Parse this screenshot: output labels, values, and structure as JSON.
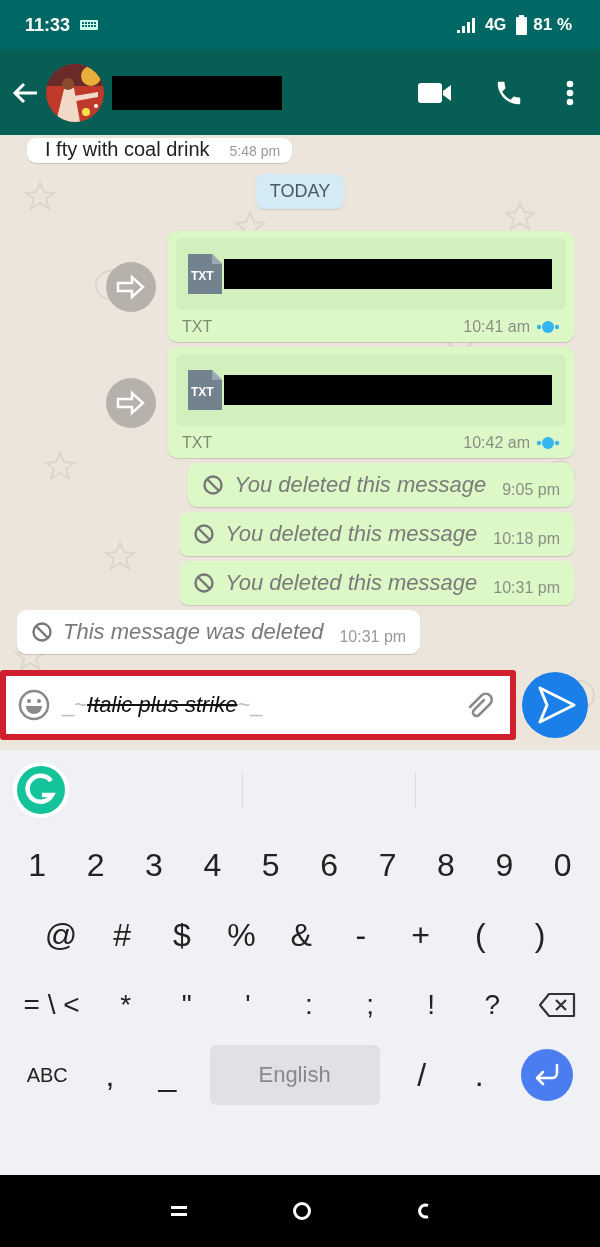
{
  "status_bar": {
    "time": "11:33",
    "network": "4G",
    "battery": "81 %"
  },
  "header": {
    "kind": "chat"
  },
  "messages": [
    {
      "kind": "text",
      "outgoing": false,
      "text": "I fty with coal drink",
      "time": "5:48 pm"
    },
    {
      "kind": "date",
      "text": "TODAY"
    },
    {
      "kind": "file",
      "outgoing": true,
      "file_type": "TXT",
      "label": "TXT",
      "time": "10:41 am",
      "read": true
    },
    {
      "kind": "file",
      "outgoing": true,
      "file_type": "TXT",
      "label": "TXT",
      "time": "10:42 am",
      "read": true
    },
    {
      "kind": "deleted",
      "outgoing": true,
      "text": "You deleted this message",
      "time": "9:05 pm"
    },
    {
      "kind": "deleted",
      "outgoing": true,
      "text": "You deleted this message",
      "time": "10:18 pm"
    },
    {
      "kind": "deleted",
      "outgoing": true,
      "text": "You deleted this message",
      "time": "10:31 pm"
    },
    {
      "kind": "deleted",
      "outgoing": false,
      "text": "This message was deleted",
      "time": "10:31 pm"
    }
  ],
  "composer": {
    "prefix": "_~",
    "value": "Italic plus strike",
    "suffix": "~_",
    "highlighted": true
  },
  "keyboard": {
    "number_keys": {
      "keys": [
        "1",
        "2",
        "3",
        "4",
        "5",
        "6",
        "7",
        "8",
        "9",
        "0"
      ]
    },
    "symbol_keys": {
      "keys": [
        "@",
        "#",
        "$",
        "%",
        "&",
        "-",
        "+",
        "(",
        ")"
      ]
    },
    "punctuation_keys": {
      "keys": [
        "= \\ <",
        "*",
        "\"",
        "'",
        ":",
        ";",
        "!",
        "?"
      ]
    },
    "bottom": {
      "left": "ABC",
      "keys": [
        ",",
        "_"
      ],
      "space": "English",
      "keys_right": [
        "/",
        "."
      ]
    }
  }
}
